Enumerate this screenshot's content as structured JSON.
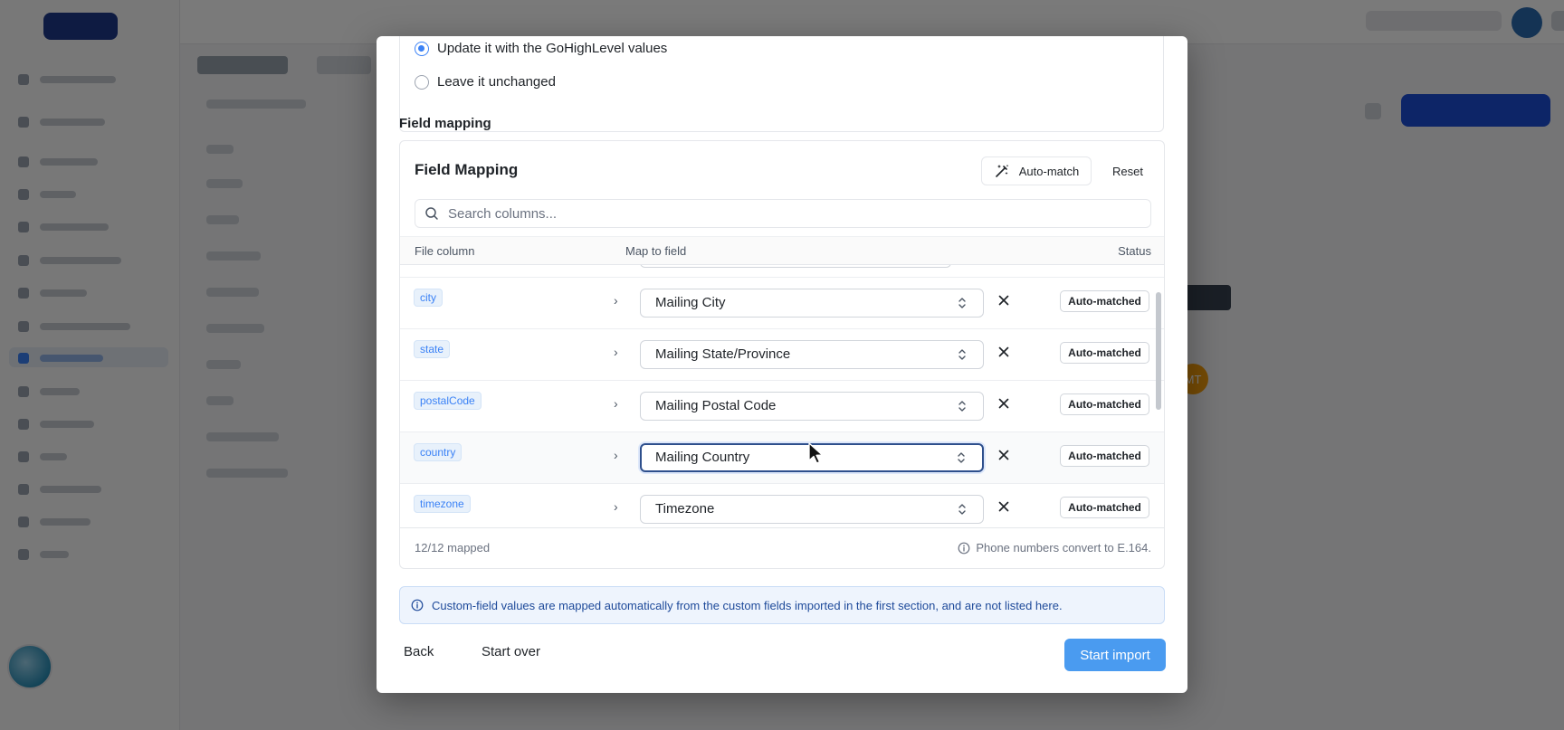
{
  "import_options": {
    "update_label": "Update it with the GoHighLevel values",
    "leave_label": "Leave it unchanged",
    "selected": "update"
  },
  "section_label": "Field mapping",
  "field_mapping": {
    "title": "Field Mapping",
    "auto_match_label": "Auto-match",
    "reset_label": "Reset",
    "search_placeholder": "Search columns...",
    "columns": {
      "file": "File column",
      "map": "Map to field",
      "status": "Status"
    },
    "rows": [
      {
        "column": "city",
        "field": "Mailing City",
        "status": "Auto-matched"
      },
      {
        "column": "state",
        "field": "Mailing State/Province",
        "status": "Auto-matched"
      },
      {
        "column": "postalCode",
        "field": "Mailing Postal Code",
        "status": "Auto-matched"
      },
      {
        "column": "country",
        "field": "Mailing Country",
        "status": "Auto-matched"
      },
      {
        "column": "timezone",
        "field": "Timezone",
        "status": "Auto-matched"
      }
    ],
    "mapped_count": "12/12 mapped",
    "phone_note": "Phone numbers convert to E.164."
  },
  "info_message": "Custom-field values are mapped automatically from the custom fields imported in the first section, and are not listed here.",
  "footer": {
    "back_label": "Back",
    "start_over_label": "Start over",
    "start_import_label": "Start import"
  },
  "background": {
    "avatar_initials": "MT"
  },
  "colors": {
    "primary": "#4a9bf0",
    "chip_text": "#3b82f6",
    "info_bg": "#eef4fd",
    "focus_border": "#2e4f8c"
  },
  "icons": {
    "auto_match": "magic-wand-icon",
    "search": "search-icon",
    "expand": "chevron-right-icon",
    "select": "up-down-chevron-icon",
    "remove": "close-icon",
    "info": "info-circle-icon"
  }
}
